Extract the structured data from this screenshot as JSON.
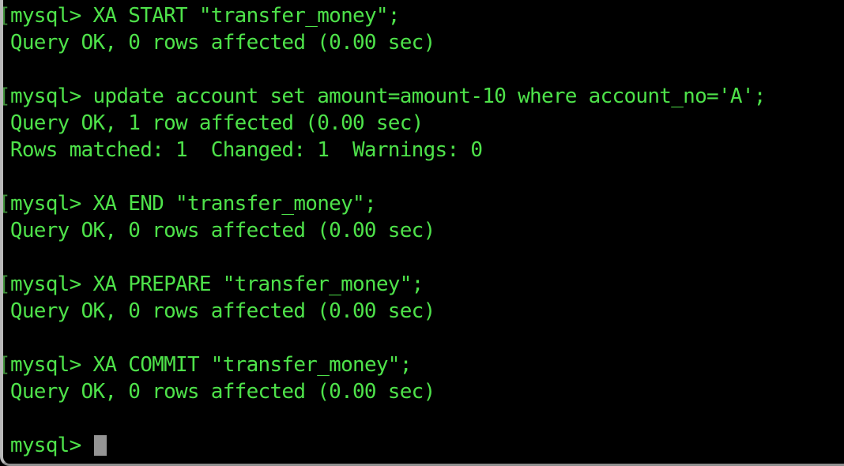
{
  "window": {
    "app": "Terminal",
    "shell_program": "mysql",
    "colors": {
      "background": "#000000",
      "foreground": "#4ee24a",
      "prompt_bracket": "#3f8f3a",
      "cursor": "#949494",
      "window_border": "#b9b9b9"
    }
  },
  "terminal": {
    "prompt": "mysql>",
    "cursor_glyph": "block-cursor",
    "lines": [
      {
        "bracket": "[",
        "text": "mysql> XA START \"transfer_money\";"
      },
      {
        "bracket": "",
        "text": " Query OK, 0 rows affected (0.00 sec)"
      },
      {
        "bracket": "",
        "text": ""
      },
      {
        "bracket": "[",
        "text": "mysql> update account set amount=amount-10 where account_no='A';"
      },
      {
        "bracket": "",
        "text": " Query OK, 1 row affected (0.00 sec)"
      },
      {
        "bracket": "",
        "text": " Rows matched: 1  Changed: 1  Warnings: 0"
      },
      {
        "bracket": "",
        "text": ""
      },
      {
        "bracket": "[",
        "text": "mysql> XA END \"transfer_money\";"
      },
      {
        "bracket": "",
        "text": " Query OK, 0 rows affected (0.00 sec)"
      },
      {
        "bracket": "",
        "text": ""
      },
      {
        "bracket": "[",
        "text": "mysql> XA PREPARE \"transfer_money\";"
      },
      {
        "bracket": "",
        "text": " Query OK, 0 rows affected (0.00 sec)"
      },
      {
        "bracket": "",
        "text": ""
      },
      {
        "bracket": "[",
        "text": "mysql> XA COMMIT \"transfer_money\";"
      },
      {
        "bracket": "",
        "text": " Query OK, 0 rows affected (0.00 sec)"
      },
      {
        "bracket": "",
        "text": ""
      }
    ],
    "current_prompt": " mysql>",
    "current_input": ""
  }
}
